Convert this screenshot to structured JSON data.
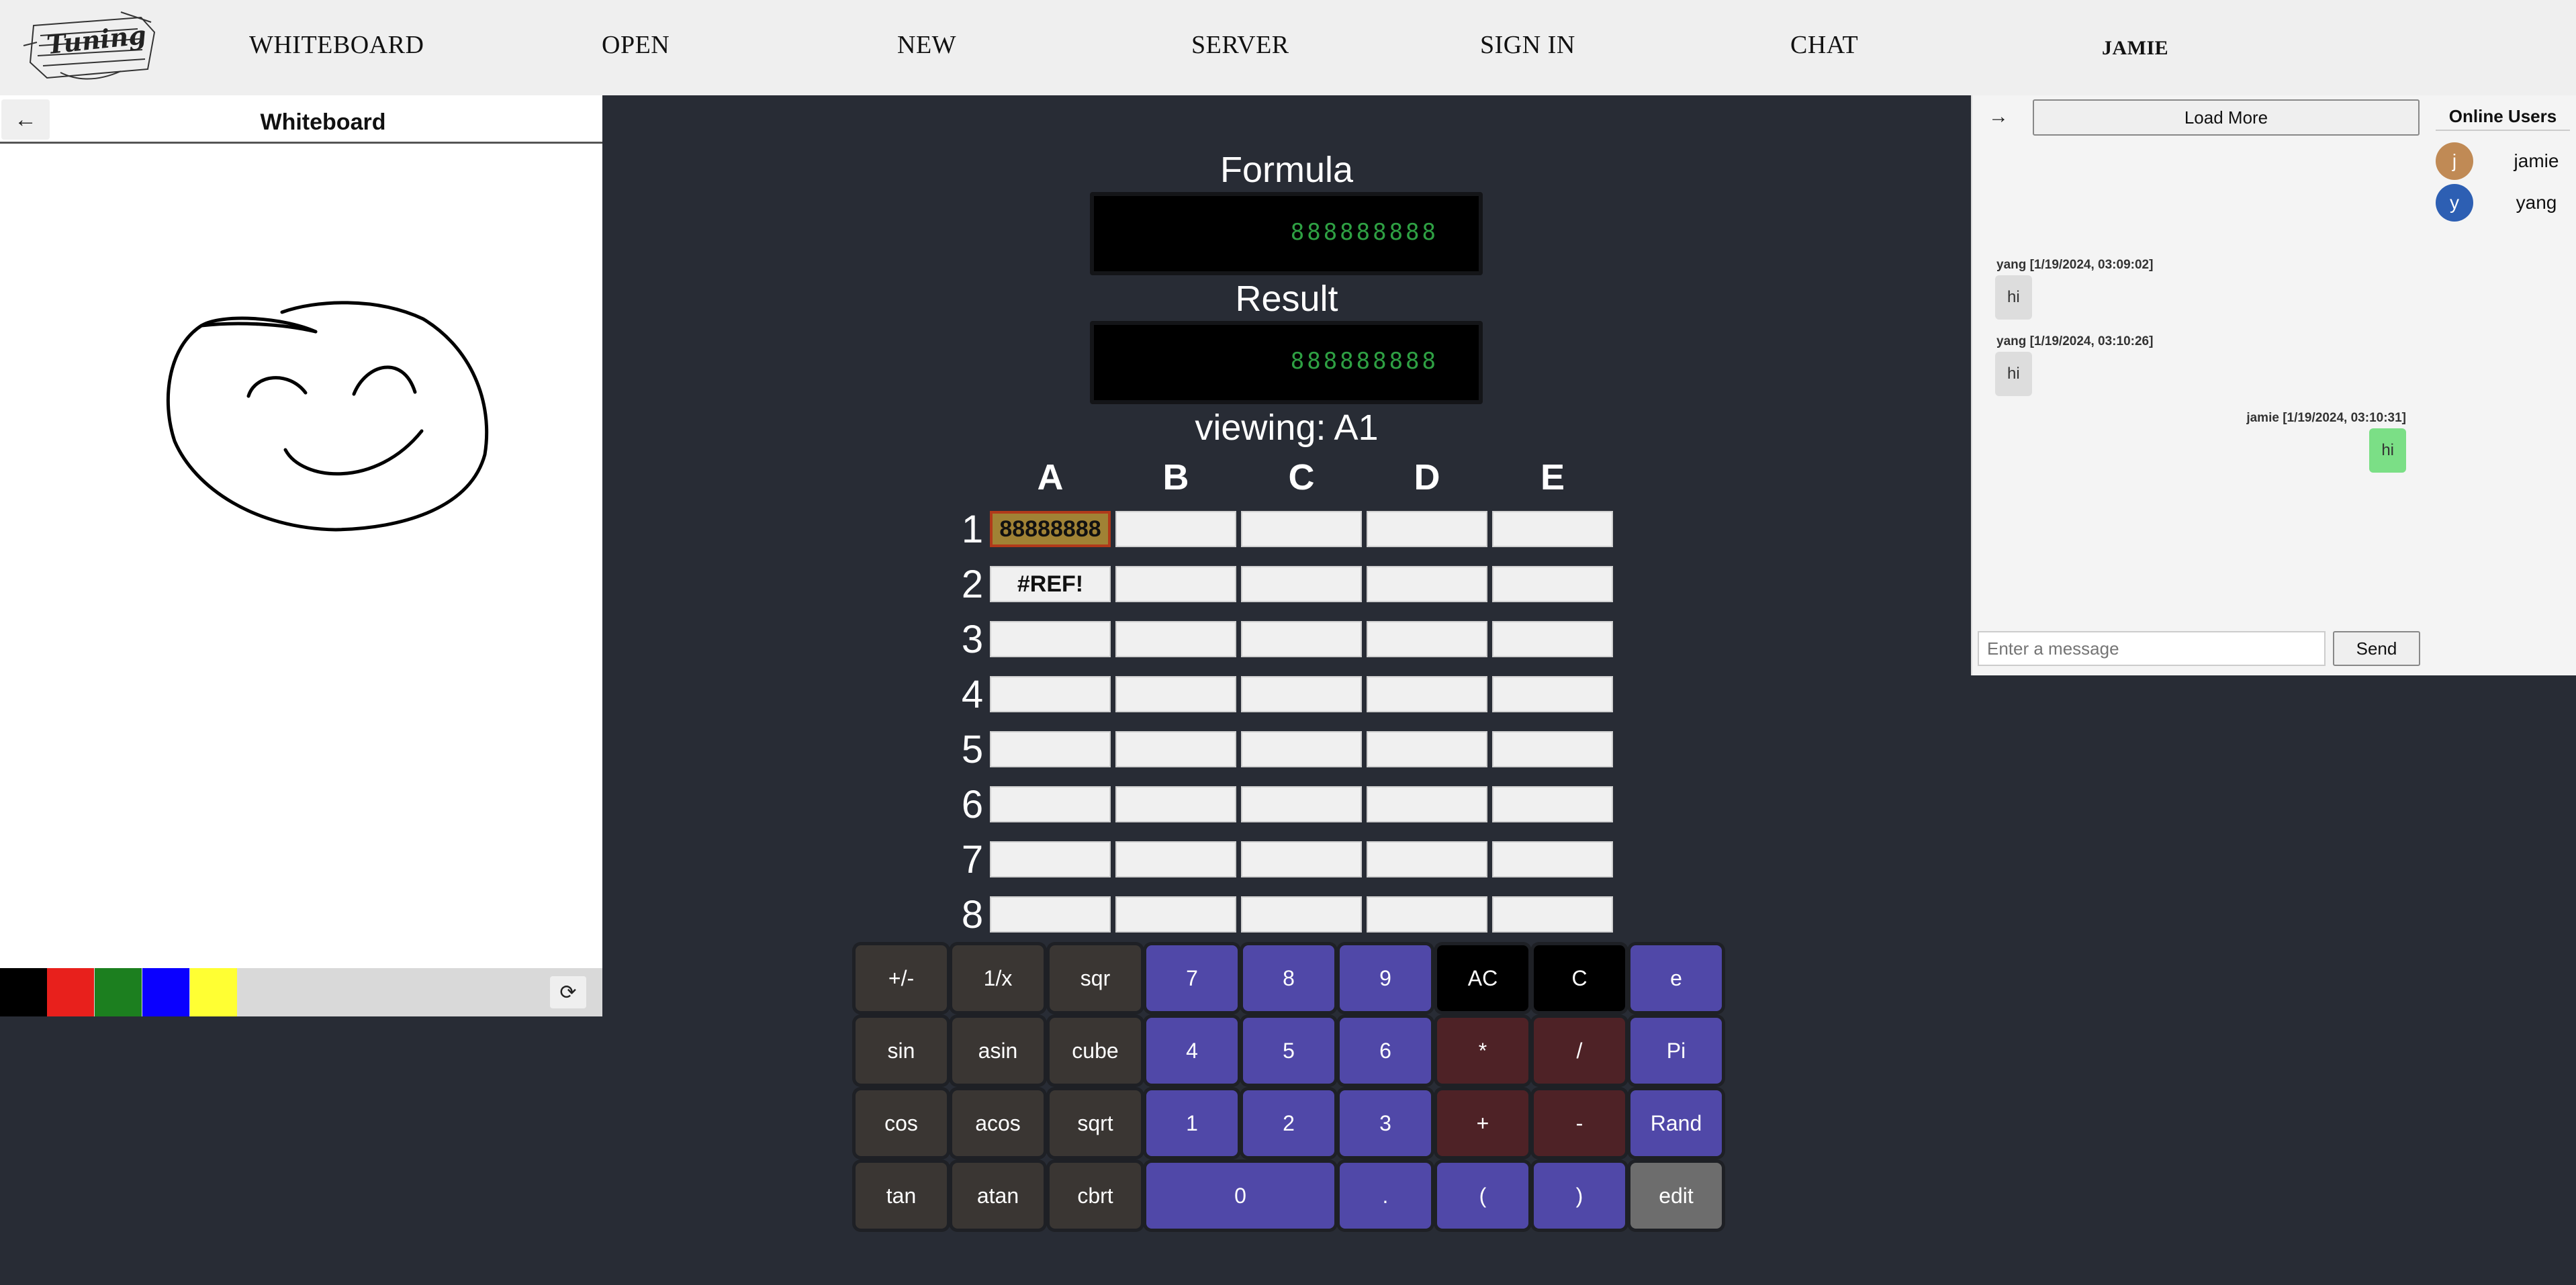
{
  "nav": {
    "logo_text": "Tuning",
    "items": [
      "WHITEBOARD",
      "OPEN",
      "NEW",
      "SERVER",
      "SIGN IN",
      "CHAT"
    ],
    "user": "JAMIE"
  },
  "whiteboard": {
    "title": "Whiteboard",
    "back_icon": "←",
    "refresh_icon": "⟳",
    "palette": [
      "#000000",
      "#e8201c",
      "#1c7f1f",
      "#0a00ff",
      "#ffff33"
    ]
  },
  "calculator": {
    "formula_label": "Formula",
    "formula_value": "888888888",
    "result_label": "Result",
    "result_value": "888888888",
    "viewing_prefix": "viewing:",
    "viewing_cell": "A1",
    "viewing_text": "viewing: A1",
    "columns": [
      "A",
      "B",
      "C",
      "D",
      "E"
    ],
    "rows": [
      "1",
      "2",
      "3",
      "4",
      "5",
      "6",
      "7",
      "8"
    ],
    "cells": {
      "A1": "88888888",
      "A2": "#REF!"
    },
    "selected_cell": "A1",
    "keys": [
      [
        "+/-",
        "1/x",
        "sqr",
        "7",
        "8",
        "9",
        "AC",
        "C",
        "e"
      ],
      [
        "sin",
        "asin",
        "cube",
        "4",
        "5",
        "6",
        "*",
        "/",
        "Pi"
      ],
      [
        "cos",
        "acos",
        "sqrt",
        "1",
        "2",
        "3",
        "+",
        "-",
        "Rand"
      ],
      [
        "tan",
        "atan",
        "cbrt",
        "0",
        ".",
        "(",
        ")",
        "edit"
      ]
    ]
  },
  "chat": {
    "collapse_icon": "→",
    "load_more": "Load More",
    "messages": [
      {
        "meta": "yang [1/19/2024, 03:09:02]",
        "text": "hi",
        "side": "left"
      },
      {
        "meta": "yang [1/19/2024, 03:10:26]",
        "text": "hi",
        "side": "left"
      },
      {
        "meta": "jamie [1/19/2024, 03:10:31]",
        "text": "hi",
        "side": "right"
      }
    ],
    "input_placeholder": "Enter a message",
    "send_label": "Send"
  },
  "online_users": {
    "title": "Online Users",
    "users": [
      {
        "initial": "j",
        "name": "jamie",
        "color": "#c08a55"
      },
      {
        "initial": "y",
        "name": "yang",
        "color": "#2d5fb3"
      }
    ]
  }
}
